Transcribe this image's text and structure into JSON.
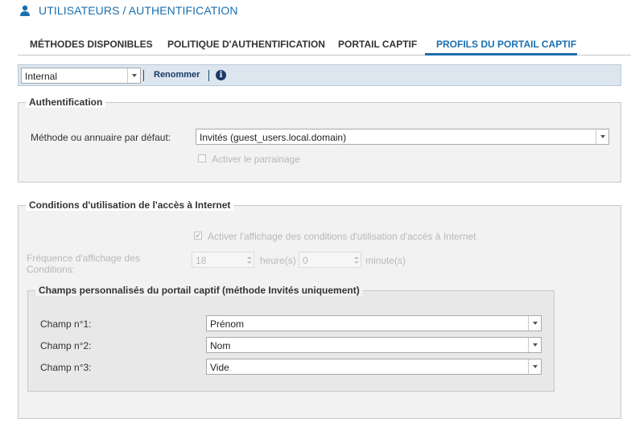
{
  "header": {
    "title": "UTILISATEURS / AUTHENTIFICATION",
    "icon": "user-icon"
  },
  "tabs": [
    {
      "label": "MÉTHODES DISPONIBLES",
      "active": false
    },
    {
      "label": "POLITIQUE D'AUTHENTIFICATION",
      "active": false
    },
    {
      "label": "PORTAIL CAPTIF",
      "active": false
    },
    {
      "label": "PROFILS DU PORTAIL CAPTIF",
      "active": true
    }
  ],
  "toolbar": {
    "profile_value": "Internal",
    "rename_label": "Renommer",
    "info_icon": "info-icon",
    "info_glyph": "i"
  },
  "authentication": {
    "legend": "Authentification",
    "default_method_label": "Méthode ou annuaire par défaut:",
    "default_method_value": "Invités (guest_users.local.domain)",
    "sponsorship_label": "Activer le parrainage",
    "sponsorship_checked": false
  },
  "conditions": {
    "legend": "Conditions d'utilisation de l'accès à Internet",
    "show_conditions_label": "Activer l'affichage des conditions d'utilisation d'accès à Internet",
    "show_conditions_checked": true,
    "frequency_label_line1": "Fréquence d'affichage des",
    "frequency_label_line2": "Conditions:",
    "hours_value": "18",
    "hours_unit": "heure(s)",
    "minutes_value": "0",
    "minutes_unit": "minute(s)",
    "custom_fields": {
      "legend": "Champs personnalisés du portail captif (méthode Invités uniquement)",
      "fields": [
        {
          "label": "Champ n°1:",
          "value": "Prénom"
        },
        {
          "label": "Champ n°2:",
          "value": "Nom"
        },
        {
          "label": "Champ n°3:",
          "value": "Vide"
        }
      ]
    }
  },
  "colors": {
    "accent": "#1a6fb0",
    "toolbar_bg": "#dde6ef",
    "panel_bg": "#f2f2f2"
  }
}
